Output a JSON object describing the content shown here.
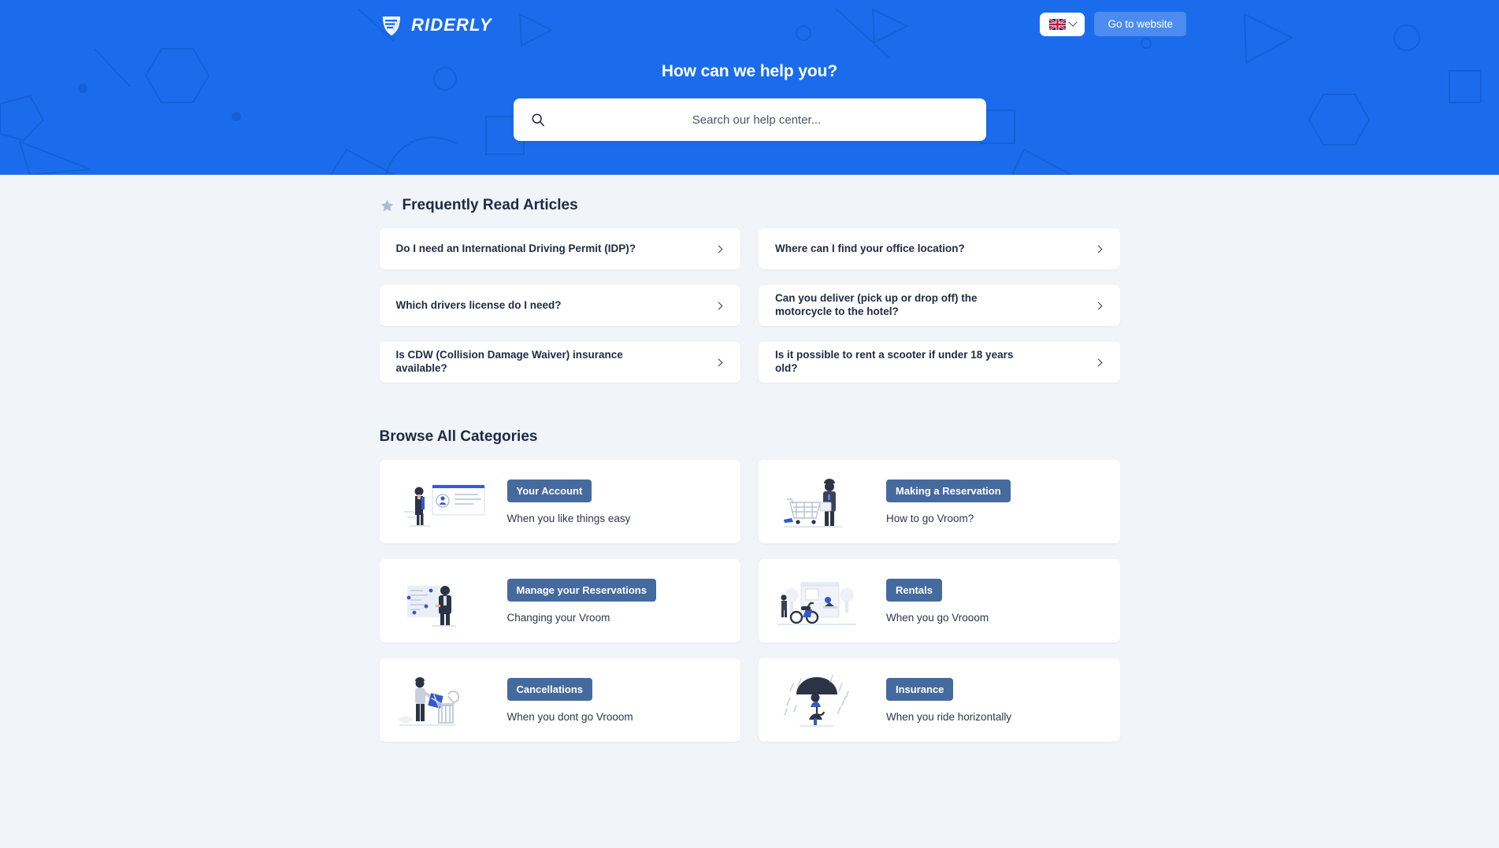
{
  "brand": {
    "name": "RIDERLY",
    "logo_icon": "riderly-shield-icon"
  },
  "colors": {
    "hero_blue": "#1a6cec",
    "page_bg": "#f1f4f9",
    "badge_blue": "#456a9e",
    "heading_navy": "#1e2a44",
    "star_grey": "#aebbd0"
  },
  "header": {
    "language": {
      "icon": "uk-flag-icon",
      "chevron": "chevron-down-icon",
      "value": "EN"
    },
    "go_to_website": "Go to website"
  },
  "hero": {
    "title": "How can we help you?",
    "search": {
      "placeholder": "Search our help center...",
      "value": "",
      "icon": "search-icon"
    }
  },
  "frequently_read": {
    "icon": "star-icon",
    "title": "Frequently Read Articles",
    "articles": [
      {
        "label": "Do I need an International Driving Permit (IDP)?",
        "chevron": "chevron-right-icon"
      },
      {
        "label": "Where can I find your office location?",
        "chevron": "chevron-right-icon"
      },
      {
        "label": "Which drivers license do I need?",
        "chevron": "chevron-right-icon"
      },
      {
        "label": "Can you deliver (pick up or drop off) the motorcycle to the hotel?",
        "chevron": "chevron-right-icon"
      },
      {
        "label": "Is CDW (Collision Damage Waiver) insurance available?",
        "chevron": "chevron-right-icon"
      },
      {
        "label": "Is it possible to rent a scooter if under 18 years old?",
        "chevron": "chevron-right-icon"
      }
    ]
  },
  "browse": {
    "title": "Browse All Categories",
    "categories": [
      {
        "badge": "Your Account",
        "subtitle": "When you like things easy",
        "illustration": "person-profile-card-illustration"
      },
      {
        "badge": "Making a Reservation",
        "subtitle": "How to go Vroom?",
        "illustration": "person-shopping-cart-illustration"
      },
      {
        "badge": "Manage your Reservations",
        "subtitle": "Changing your Vroom",
        "illustration": "person-data-list-illustration"
      },
      {
        "badge": "Rentals",
        "subtitle": "When you go Vrooom",
        "illustration": "scooter-storefront-illustration"
      },
      {
        "badge": "Cancellations",
        "subtitle": "When you dont go Vrooom",
        "illustration": "person-trash-bin-illustration"
      },
      {
        "badge": "Insurance",
        "subtitle": "When you ride horizontally",
        "illustration": "person-umbrella-rain-illustration"
      }
    ]
  }
}
